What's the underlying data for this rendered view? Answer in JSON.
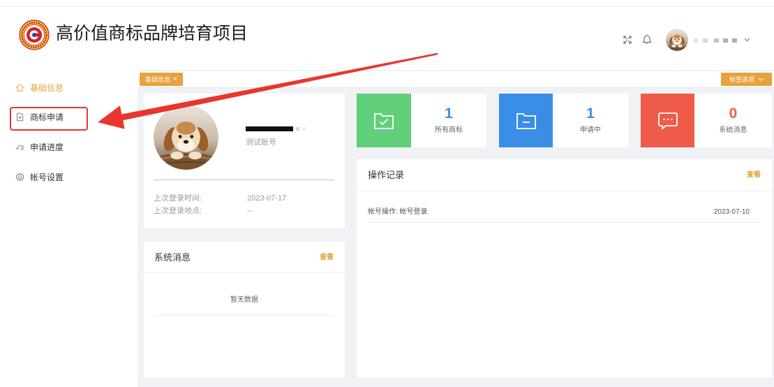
{
  "header": {
    "title": "高价值商标品牌培育项目"
  },
  "sidebar": {
    "items": [
      {
        "label": "基础信息",
        "icon": "home-icon",
        "active": true
      },
      {
        "label": "商标申请",
        "icon": "file-plus-icon",
        "active": false
      },
      {
        "label": "申请进度",
        "icon": "checklist-icon",
        "active": false
      },
      {
        "label": "帐号设置",
        "icon": "gear-icon",
        "active": false
      }
    ]
  },
  "tabs": {
    "items": [
      {
        "label": "基础信息",
        "close": "×"
      }
    ],
    "options_label": "标签选项"
  },
  "profile": {
    "account_type": "测试账号",
    "last_login_time_label": "上次登录时间:",
    "last_login_time": "2023-07-17",
    "last_login_place_label": "上次登录地点:",
    "last_login_place": "--"
  },
  "stats": [
    {
      "value": "1",
      "label": "所有商标",
      "color": "#62cf7a",
      "value_color": "#3a8ee6",
      "icon": "folder-check-icon"
    },
    {
      "value": "1",
      "label": "申请中",
      "color": "#3a8ee6",
      "value_color": "#3a8ee6",
      "icon": "folder-minus-icon"
    },
    {
      "value": "0",
      "label": "系统消息",
      "color": "#ee5b48",
      "value_color": "#f2603e",
      "icon": "message-icon"
    }
  ],
  "messages": {
    "title": "系统消息",
    "view_label": "查看",
    "empty_text": "暂无数据"
  },
  "operations": {
    "title": "操作记录",
    "view_label": "查看",
    "rows": [
      {
        "text": "帐号操作: 帐号登录",
        "date": "2023-07-10"
      }
    ]
  },
  "theme": {
    "accent": "#e6a23c",
    "background": "#f0f2f5",
    "annotation": "#e8362c"
  }
}
